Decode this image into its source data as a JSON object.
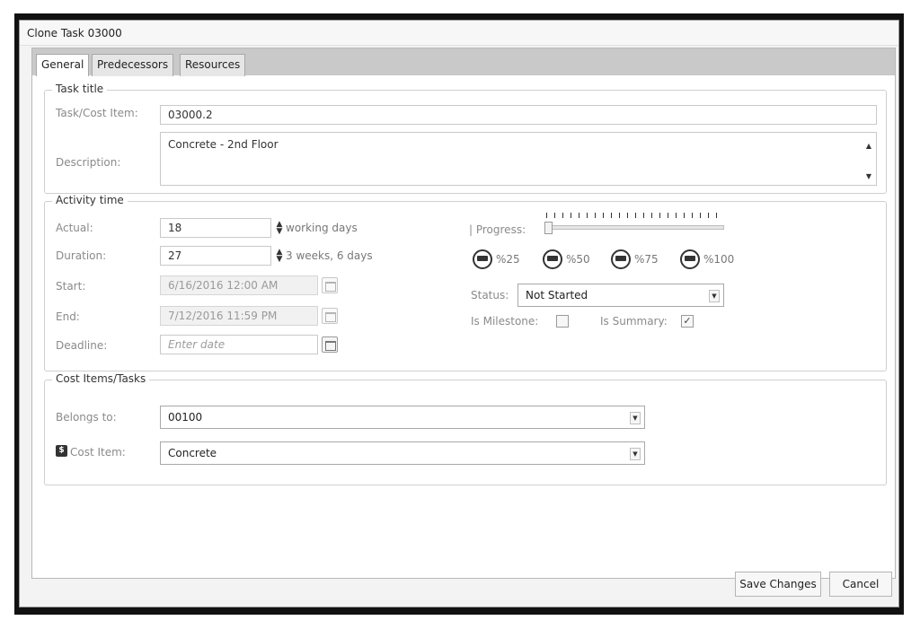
{
  "window": {
    "title": "Clone Task 03000"
  },
  "tabs": [
    {
      "label": "General"
    },
    {
      "label": "Predecessors"
    },
    {
      "label": "Resources"
    }
  ],
  "task_title": {
    "legend": "Task title",
    "task_cost_item_label": "Task/Cost Item:",
    "task_cost_item_value": "03000.2",
    "description_label": "Description:",
    "description_value": "Concrete - 2nd Floor"
  },
  "activity_time": {
    "legend": "Activity time",
    "actual_label": "Actual:",
    "actual_value": "18",
    "actual_unit": "working days",
    "duration_label": "Duration:",
    "duration_value": "27",
    "duration_unit": "3 weeks, 6 days",
    "start_label": "Start:",
    "start_value": "6/16/2016 12:00 AM",
    "end_label": "End:",
    "end_value": "7/12/2016 11:59 PM",
    "deadline_label": "Deadline:",
    "deadline_placeholder": "Enter date",
    "progress_label": "| Progress:",
    "progress_value": 0,
    "progress_buttons": [
      "%25",
      "%50",
      "%75",
      "%100"
    ],
    "status_label": "Status:",
    "status_value": "Not Started",
    "is_milestone_label": "Is Milestone:",
    "is_milestone_checked": false,
    "is_summary_label": "Is Summary:",
    "is_summary_checked": true
  },
  "cost_items": {
    "legend": "Cost Items/Tasks",
    "belongs_to_label": "Belongs to:",
    "belongs_to_value": "00100",
    "cost_item_label": "Cost Item:",
    "cost_item_value": "Concrete"
  },
  "footer": {
    "save_label": "Save Changes",
    "cancel_label": "Cancel"
  },
  "icons": {
    "check_glyph": "✓",
    "money_glyph": "$"
  }
}
